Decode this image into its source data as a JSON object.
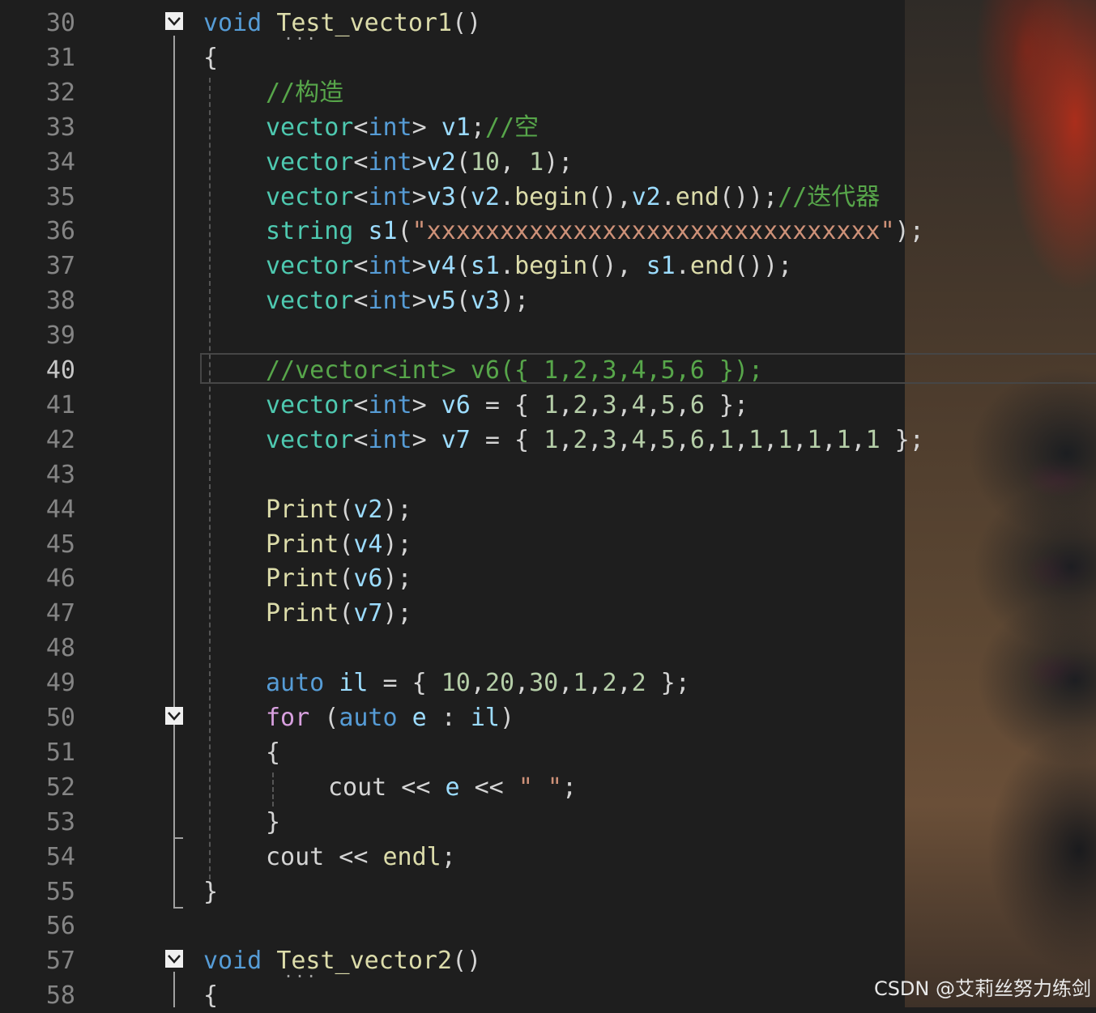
{
  "editor": {
    "lines": [
      {
        "n": "30",
        "indent": 0,
        "tokens": [
          [
            "kw",
            "void"
          ],
          [
            "pu",
            " "
          ],
          [
            "fn",
            "Test_vector1"
          ],
          [
            "pu",
            "()"
          ]
        ]
      },
      {
        "n": "31",
        "indent": 0,
        "tokens": [
          [
            "pu",
            "{"
          ]
        ]
      },
      {
        "n": "32",
        "indent": 1,
        "tokens": [
          [
            "cm",
            "//构造"
          ]
        ]
      },
      {
        "n": "33",
        "indent": 1,
        "tokens": [
          [
            "ty",
            "vector"
          ],
          [
            "pu",
            "<"
          ],
          [
            "kw",
            "int"
          ],
          [
            "pu",
            "> "
          ],
          [
            "var",
            "v1"
          ],
          [
            "pu",
            ";"
          ],
          [
            "cm",
            "//空"
          ]
        ]
      },
      {
        "n": "34",
        "indent": 1,
        "tokens": [
          [
            "ty",
            "vector"
          ],
          [
            "pu",
            "<"
          ],
          [
            "kw",
            "int"
          ],
          [
            "pu",
            ">"
          ],
          [
            "var",
            "v2"
          ],
          [
            "pu",
            "("
          ],
          [
            "num",
            "10"
          ],
          [
            "pu",
            ", "
          ],
          [
            "num",
            "1"
          ],
          [
            "pu",
            ");"
          ]
        ]
      },
      {
        "n": "35",
        "indent": 1,
        "tokens": [
          [
            "ty",
            "vector"
          ],
          [
            "pu",
            "<"
          ],
          [
            "kw",
            "int"
          ],
          [
            "pu",
            ">"
          ],
          [
            "var",
            "v3"
          ],
          [
            "pu",
            "("
          ],
          [
            "var",
            "v2"
          ],
          [
            "pu",
            "."
          ],
          [
            "fn",
            "begin"
          ],
          [
            "pu",
            "(),"
          ],
          [
            "var",
            "v2"
          ],
          [
            "pu",
            "."
          ],
          [
            "fn",
            "end"
          ],
          [
            "pu",
            "());"
          ],
          [
            "cm",
            "//迭代器"
          ]
        ]
      },
      {
        "n": "36",
        "indent": 1,
        "tokens": [
          [
            "ty",
            "string"
          ],
          [
            "pu",
            " "
          ],
          [
            "var",
            "s1"
          ],
          [
            "pu",
            "("
          ],
          [
            "str",
            "\"xxxxxxxxxxxxxxxxxxxxxxxxxxxxxxx\""
          ],
          [
            "pu",
            ");"
          ]
        ]
      },
      {
        "n": "37",
        "indent": 1,
        "tokens": [
          [
            "ty",
            "vector"
          ],
          [
            "pu",
            "<"
          ],
          [
            "kw",
            "int"
          ],
          [
            "pu",
            ">"
          ],
          [
            "var",
            "v4"
          ],
          [
            "pu",
            "("
          ],
          [
            "var",
            "s1"
          ],
          [
            "pu",
            "."
          ],
          [
            "fn",
            "begin"
          ],
          [
            "pu",
            "(), "
          ],
          [
            "var",
            "s1"
          ],
          [
            "pu",
            "."
          ],
          [
            "fn",
            "end"
          ],
          [
            "pu",
            "());"
          ]
        ]
      },
      {
        "n": "38",
        "indent": 1,
        "tokens": [
          [
            "ty",
            "vector"
          ],
          [
            "pu",
            "<"
          ],
          [
            "kw",
            "int"
          ],
          [
            "pu",
            ">"
          ],
          [
            "var",
            "v5"
          ],
          [
            "pu",
            "("
          ],
          [
            "var",
            "v3"
          ],
          [
            "pu",
            ");"
          ]
        ]
      },
      {
        "n": "39",
        "indent": 1,
        "tokens": []
      },
      {
        "n": "40",
        "indent": 1,
        "tokens": [
          [
            "cm",
            "//vector<int> v6({ 1,2,3,4,5,6 });"
          ]
        ]
      },
      {
        "n": "41",
        "indent": 1,
        "tokens": [
          [
            "ty",
            "vector"
          ],
          [
            "pu",
            "<"
          ],
          [
            "kw",
            "int"
          ],
          [
            "pu",
            "> "
          ],
          [
            "var",
            "v6"
          ],
          [
            "pu",
            " = { "
          ],
          [
            "num",
            "1"
          ],
          [
            "pu",
            ","
          ],
          [
            "num",
            "2"
          ],
          [
            "pu",
            ","
          ],
          [
            "num",
            "3"
          ],
          [
            "pu",
            ","
          ],
          [
            "num",
            "4"
          ],
          [
            "pu",
            ","
          ],
          [
            "num",
            "5"
          ],
          [
            "pu",
            ","
          ],
          [
            "num",
            "6"
          ],
          [
            "pu",
            " };"
          ]
        ]
      },
      {
        "n": "42",
        "indent": 1,
        "tokens": [
          [
            "ty",
            "vector"
          ],
          [
            "pu",
            "<"
          ],
          [
            "kw",
            "int"
          ],
          [
            "pu",
            "> "
          ],
          [
            "var",
            "v7"
          ],
          [
            "pu",
            " = { "
          ],
          [
            "num",
            "1"
          ],
          [
            "pu",
            ","
          ],
          [
            "num",
            "2"
          ],
          [
            "pu",
            ","
          ],
          [
            "num",
            "3"
          ],
          [
            "pu",
            ","
          ],
          [
            "num",
            "4"
          ],
          [
            "pu",
            ","
          ],
          [
            "num",
            "5"
          ],
          [
            "pu",
            ","
          ],
          [
            "num",
            "6"
          ],
          [
            "pu",
            ","
          ],
          [
            "num",
            "1"
          ],
          [
            "pu",
            ","
          ],
          [
            "num",
            "1"
          ],
          [
            "pu",
            ","
          ],
          [
            "num",
            "1"
          ],
          [
            "pu",
            ","
          ],
          [
            "num",
            "1"
          ],
          [
            "pu",
            ","
          ],
          [
            "num",
            "1"
          ],
          [
            "pu",
            ","
          ],
          [
            "num",
            "1"
          ],
          [
            "pu",
            " };"
          ]
        ]
      },
      {
        "n": "43",
        "indent": 1,
        "tokens": []
      },
      {
        "n": "44",
        "indent": 1,
        "tokens": [
          [
            "fn",
            "Print"
          ],
          [
            "pu",
            "("
          ],
          [
            "var",
            "v2"
          ],
          [
            "pu",
            ");"
          ]
        ]
      },
      {
        "n": "45",
        "indent": 1,
        "tokens": [
          [
            "fn",
            "Print"
          ],
          [
            "pu",
            "("
          ],
          [
            "var",
            "v4"
          ],
          [
            "pu",
            ");"
          ]
        ]
      },
      {
        "n": "46",
        "indent": 1,
        "tokens": [
          [
            "fn",
            "Print"
          ],
          [
            "pu",
            "("
          ],
          [
            "var",
            "v6"
          ],
          [
            "pu",
            ");"
          ]
        ]
      },
      {
        "n": "47",
        "indent": 1,
        "tokens": [
          [
            "fn",
            "Print"
          ],
          [
            "pu",
            "("
          ],
          [
            "var",
            "v7"
          ],
          [
            "pu",
            ");"
          ]
        ]
      },
      {
        "n": "48",
        "indent": 1,
        "tokens": []
      },
      {
        "n": "49",
        "indent": 1,
        "tokens": [
          [
            "kw",
            "auto"
          ],
          [
            "pu",
            " "
          ],
          [
            "var",
            "il"
          ],
          [
            "pu",
            " = { "
          ],
          [
            "num",
            "10"
          ],
          [
            "pu",
            ","
          ],
          [
            "num",
            "20"
          ],
          [
            "pu",
            ","
          ],
          [
            "num",
            "30"
          ],
          [
            "pu",
            ","
          ],
          [
            "num",
            "1"
          ],
          [
            "pu",
            ","
          ],
          [
            "num",
            "2"
          ],
          [
            "pu",
            ","
          ],
          [
            "num",
            "2"
          ],
          [
            "pu",
            " };"
          ]
        ]
      },
      {
        "n": "50",
        "indent": 1,
        "tokens": [
          [
            "ctl",
            "for"
          ],
          [
            "pu",
            " ("
          ],
          [
            "kw",
            "auto"
          ],
          [
            "pu",
            " "
          ],
          [
            "var",
            "e"
          ],
          [
            "pu",
            " : "
          ],
          [
            "var",
            "il"
          ],
          [
            "pu",
            ")"
          ]
        ]
      },
      {
        "n": "51",
        "indent": 1,
        "tokens": [
          [
            "pu",
            "{"
          ]
        ]
      },
      {
        "n": "52",
        "indent": 2,
        "tokens": [
          [
            "id",
            "cout"
          ],
          [
            "pu",
            " << "
          ],
          [
            "var",
            "e"
          ],
          [
            "pu",
            " << "
          ],
          [
            "str",
            "\" \""
          ],
          [
            "pu",
            ";"
          ]
        ]
      },
      {
        "n": "53",
        "indent": 1,
        "tokens": [
          [
            "pu",
            "}"
          ]
        ]
      },
      {
        "n": "54",
        "indent": 1,
        "tokens": [
          [
            "id",
            "cout"
          ],
          [
            "pu",
            " << "
          ],
          [
            "fn",
            "endl"
          ],
          [
            "pu",
            ";"
          ]
        ]
      },
      {
        "n": "55",
        "indent": 0,
        "tokens": [
          [
            "pu",
            "}"
          ]
        ]
      },
      {
        "n": "56",
        "indent": 0,
        "tokens": []
      },
      {
        "n": "57",
        "indent": 0,
        "tokens": [
          [
            "kw",
            "void"
          ],
          [
            "pu",
            " "
          ],
          [
            "fn",
            "Test_vector2"
          ],
          [
            "pu",
            "()"
          ]
        ]
      },
      {
        "n": "58",
        "indent": 0,
        "tokens": [
          [
            "pu",
            "{"
          ]
        ]
      }
    ],
    "current_line": "40"
  },
  "colors": {
    "background": "#1e1e1e",
    "keyword": "#569cd6",
    "type": "#4ec9b0",
    "function": "#dcdcaa",
    "variable": "#9cdcfe",
    "number": "#b5cea8",
    "string": "#ce9178",
    "comment": "#57a64a",
    "control": "#d8a0df"
  },
  "watermark": "CSDN @艾莉丝努力练剑"
}
